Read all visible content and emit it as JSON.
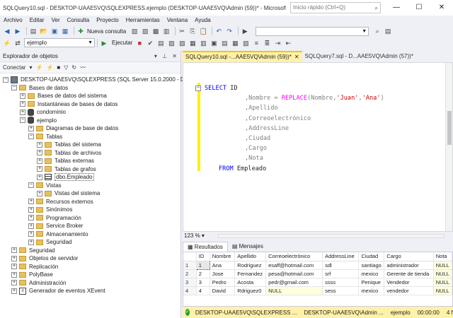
{
  "window": {
    "title": "SQLQuery10.sql - DESKTOP-UAAE5VQ\\SQLEXPRESS.ejemplo (DESKTOP-UAAE5VQ\\Admin (59))* - Microsoft SQL Se...",
    "quick_search_placeholder": "Inicio rápido (Ctrl+Q)",
    "min": "—",
    "max": "☐",
    "close": "✕"
  },
  "menu": [
    "Archivo",
    "Editar",
    "Ver",
    "Consulta",
    "Proyecto",
    "Herramientas",
    "Ventana",
    "Ayuda"
  ],
  "toolbar": {
    "new_query": "Nueva consulta",
    "database": "ejemplo",
    "execute": "Ejecutar"
  },
  "object_explorer": {
    "title": "Explorador de objetos",
    "connect": "Conectar",
    "tree": [
      {
        "label": "DESKTOP-UAAE5VQ\\SQLEXPRESS (SQL Server 15.0.2000 - DESK",
        "level": 0,
        "exp": "−",
        "icon": "server"
      },
      {
        "label": "Bases de datos",
        "level": 1,
        "exp": "−",
        "icon": "folder"
      },
      {
        "label": "Bases de datos del sistema",
        "level": 2,
        "exp": "+",
        "icon": "folder"
      },
      {
        "label": "Instantáneas de bases de datos",
        "level": 2,
        "exp": "+",
        "icon": "folder"
      },
      {
        "label": "condominio",
        "level": 2,
        "exp": "+",
        "icon": "db"
      },
      {
        "label": "ejemplo",
        "level": 2,
        "exp": "−",
        "icon": "db"
      },
      {
        "label": "Diagramas de base de datos",
        "level": 3,
        "exp": "+",
        "icon": "folder"
      },
      {
        "label": "Tablas",
        "level": 3,
        "exp": "−",
        "icon": "folder"
      },
      {
        "label": "Tablas del sistema",
        "level": 4,
        "exp": "+",
        "icon": "folder"
      },
      {
        "label": "Tablas de archivos",
        "level": 4,
        "exp": "+",
        "icon": "folder"
      },
      {
        "label": "Tablas externas",
        "level": 4,
        "exp": "+",
        "icon": "folder"
      },
      {
        "label": "Tablas de grafos",
        "level": 4,
        "exp": "+",
        "icon": "folder"
      },
      {
        "label": "dbo.Empleado",
        "level": 4,
        "exp": "+",
        "icon": "table"
      },
      {
        "label": "Vistas",
        "level": 3,
        "exp": "−",
        "icon": "folder"
      },
      {
        "label": "Vistas del sistema",
        "level": 4,
        "exp": "+",
        "icon": "folder"
      },
      {
        "label": "Recursos externos",
        "level": 3,
        "exp": "+",
        "icon": "folder"
      },
      {
        "label": "Sinónimos",
        "level": 3,
        "exp": "+",
        "icon": "folder"
      },
      {
        "label": "Programación",
        "level": 3,
        "exp": "+",
        "icon": "folder"
      },
      {
        "label": "Service Broker",
        "level": 3,
        "exp": "+",
        "icon": "folder"
      },
      {
        "label": "Almacenamiento",
        "level": 3,
        "exp": "+",
        "icon": "folder"
      },
      {
        "label": "Seguridad",
        "level": 3,
        "exp": "+",
        "icon": "folder"
      },
      {
        "label": "Seguridad",
        "level": 1,
        "exp": "+",
        "icon": "folder"
      },
      {
        "label": "Objetos de servidor",
        "level": 1,
        "exp": "+",
        "icon": "folder"
      },
      {
        "label": "Replicación",
        "level": 1,
        "exp": "+",
        "icon": "folder"
      },
      {
        "label": "PolyBase",
        "level": 1,
        "exp": "+",
        "icon": "folder"
      },
      {
        "label": "Administración",
        "level": 1,
        "exp": "+",
        "icon": "folder"
      },
      {
        "label": "Generador de eventos XEvent",
        "level": 1,
        "exp": "+",
        "icon": "xevent"
      }
    ]
  },
  "tabs": {
    "active": "SQLQuery10.sql -...AAE5VQ\\Admin (59))*",
    "inactive": "SQLQuery7.sql - D...AAE5VQ\\Admin (57))*"
  },
  "code": {
    "l1_kw": "SELECT",
    "l1_rest": " ID",
    "l2_a": ",Nombre ",
    "l2_eq": "=",
    "l2_fn": " REPLACE",
    "l2_p1": "(Nombre,",
    "l2_s1": "'Juan'",
    "l2_c": ",",
    "l2_s2": "'Ana'",
    "l2_p2": ")",
    "l3": ",Apellido",
    "l4": ",Correoelectrónico",
    "l5": ",AddressLine",
    "l6": ",Ciudad",
    "l7": ",Cargo",
    "l8": ",Nota",
    "l9_kw": "FROM",
    "l9_rest": " Empleado"
  },
  "zoom": "123 %",
  "results": {
    "tab_results": "Resultados",
    "tab_messages": "Mensajes",
    "columns": [
      "",
      "ID",
      "Nombre",
      "Apellido",
      "Correoelectrónico",
      "AddressLine",
      "Ciudad",
      "Cargo",
      "Nota"
    ],
    "rows": [
      [
        "1",
        "1",
        "Ana",
        "Rodriguez",
        "esaff@hotmail.com",
        "sdl",
        "santiago",
        "administrador",
        "NULL"
      ],
      [
        "2",
        "2",
        "Jose",
        "Fernandez",
        "pesa@hotmail.com",
        "srf",
        "mexico",
        "Gerente de tienda",
        "NULL"
      ],
      [
        "3",
        "3",
        "Pedro",
        "Acosta",
        "pedr@gmail.com",
        "ssss",
        "Penique",
        "Vendedor",
        "NULL"
      ],
      [
        "4",
        "4",
        "David",
        "Rdriguez0",
        "NULL",
        "sess",
        "mexico",
        "vendedor",
        "NULL"
      ]
    ]
  },
  "status": {
    "server": "DESKTOP-UAAE5VQ\\SQLEXPRESS ...",
    "user": "DESKTOP-UAAE5VQ\\Admin ...",
    "db": "ejemplo",
    "time": "00:00:00",
    "rows": "4 filas"
  },
  "colors": {
    "accent_tab": "#fff1a8",
    "status_ok": "#2a9d2a",
    "keyword": "#0000ff",
    "string": "#d00000",
    "function": "#ff00ff"
  }
}
